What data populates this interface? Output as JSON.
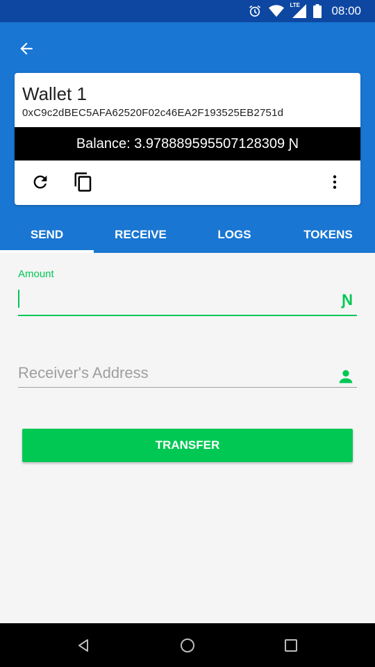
{
  "status_bar": {
    "time": "08:00",
    "network_label": "LTE",
    "icons": [
      "alarm-icon",
      "wifi-icon",
      "signal-icon",
      "battery-icon"
    ]
  },
  "app_bar": {
    "back_icon": "arrow-left-icon"
  },
  "wallet": {
    "name": "Wallet 1",
    "address": "0xC9c2dBEC5AFA62520F02c46EA2F193525EB2751d",
    "balance": "Balance: 3.978889595507128309 Ɲ",
    "actions": [
      "refresh-icon",
      "copy-icon",
      "more-vert-icon"
    ]
  },
  "tabs": [
    {
      "label": "SEND",
      "active": true
    },
    {
      "label": "RECEIVE",
      "active": false
    },
    {
      "label": "LOGS",
      "active": false
    },
    {
      "label": "TOKENS",
      "active": false
    }
  ],
  "form": {
    "amount_label": "Amount",
    "amount_value": "",
    "currency_symbol": "Ɲ",
    "receiver_placeholder": "Receiver's Address",
    "transfer_label": "TRANSFER"
  },
  "colors": {
    "primary": "#1976d2",
    "status_bar": "#0d47a1",
    "accent": "#00c853"
  }
}
